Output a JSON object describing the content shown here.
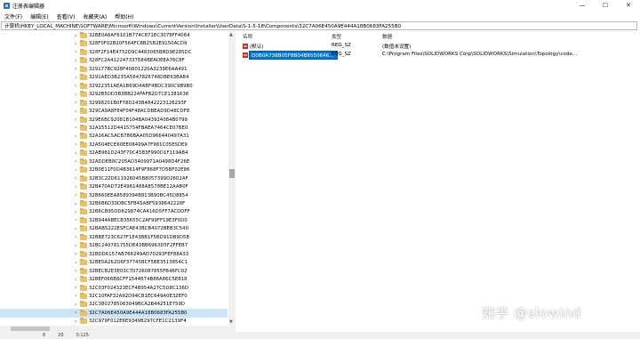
{
  "window": {
    "title": "注册表编辑器",
    "controls": {
      "minimize": "—",
      "maximize": "☐",
      "close": "✕"
    }
  },
  "menu": [
    "文件(F)",
    "编辑(E)",
    "查看(V)",
    "收藏夹(A)",
    "帮助(H)"
  ],
  "address": "计算机\\HKEY_LOCAL_MACHINE\\SOFTWARE\\Microsoft\\Windows\\CurrentVersion\\Installer\\UserData\\S-1-5-18\\Components\\32C7A06E450A9E444A18B0683FA255B0",
  "tree": {
    "keys": [
      "32BE0A6AF6101B774C871EC3078FF4064",
      "328F0F02B20F564FC8B25B2E9150ACD9",
      "328F2F14E4752D9C4483065BBD9E28SDC",
      "328FC2A412247337E84BEADEEA76C8F",
      "329177BC928F40801220A3239E6AA491",
      "3291AED3B235A5647828748DBE63BA84",
      "32922351AEA1B69D4ABF4BDC390C9B9B0",
      "3292B5DD3B3BB224FAFB2D7CE1381636",
      "32998201B0F78D243B4842223126293F",
      "329CA9A8F84F04F48ACDBEAD9D48CDF8",
      "329E6BC92081B104BA043924084B0799",
      "32A15512D4415754FBAEA7464CE07BE0",
      "32A16AC5ACB786BAA05D966440497A31",
      "32A504ECE60EE08499A7F981C05ESDE9",
      "32AB961D243F70C45B3F990D1F119AB4",
      "32ADDEB8C205AD3409971A0498D4F26E",
      "32B0E11F0D4B3614F9F868F7D5BF02E86",
      "32B3C22D611926045B8057399D2602AF",
      "32B470AD72E4961488A8578BE12AAB0F",
      "32B660EEA8589394B813B90BC45D8854",
      "32B6B6D30DBC5FB45ABF5938642228F",
      "32B6CB95DD629874CA416D5FF7ACDDFF",
      "32B944ABECB35655C2AF99FF19E3F0D0",
      "32BAB5222ESFCAE43BCB4072BEB3C540",
      "32BBE723C627F1E43BB1F5BD91DB9D5B",
      "32BC240781755DE43BB6963D5F2FFEB7",
      "32BDD6157AB766249AD70293FEF88A33",
      "32BE5A262D6F37745BCF5BE3513854C1",
      "32BECB2E3E03C70726087855FB46FC02",
      "32BEF066B6CFF1544B74B86A86C5E818",
      "32C03F024323ECF4B954A27C5D8C136D",
      "32C10FAF32A92D94CB1EC649A0E32EF0",
      "32C3802785063049BCA2B44251E759D",
      "32C7A06E450A9E444A18B0683FA255B0",
      "32C979F012E6E9349B297CFE1C2139F4"
    ],
    "selected_index": 33
  },
  "values": {
    "columns": {
      "name": "名称",
      "type": "类型",
      "data": "数据"
    },
    "rows": [
      {
        "icon": "ab",
        "name": "(默认)",
        "type": "REG_SZ",
        "data": "(数值未设置)"
      },
      {
        "icon": "ab",
        "name": "D0B0A738B05F8B04B8550646...",
        "type": "REG_SZ",
        "data": "C:\\Program Files\\SOLIDWORKS Corp\\SOLIDWORKS\\Simulation\\Topology\\code..."
      }
    ]
  },
  "statusbar": [
    "6",
    "20",
    "0.125"
  ],
  "watermark": "知乎 @slowind"
}
